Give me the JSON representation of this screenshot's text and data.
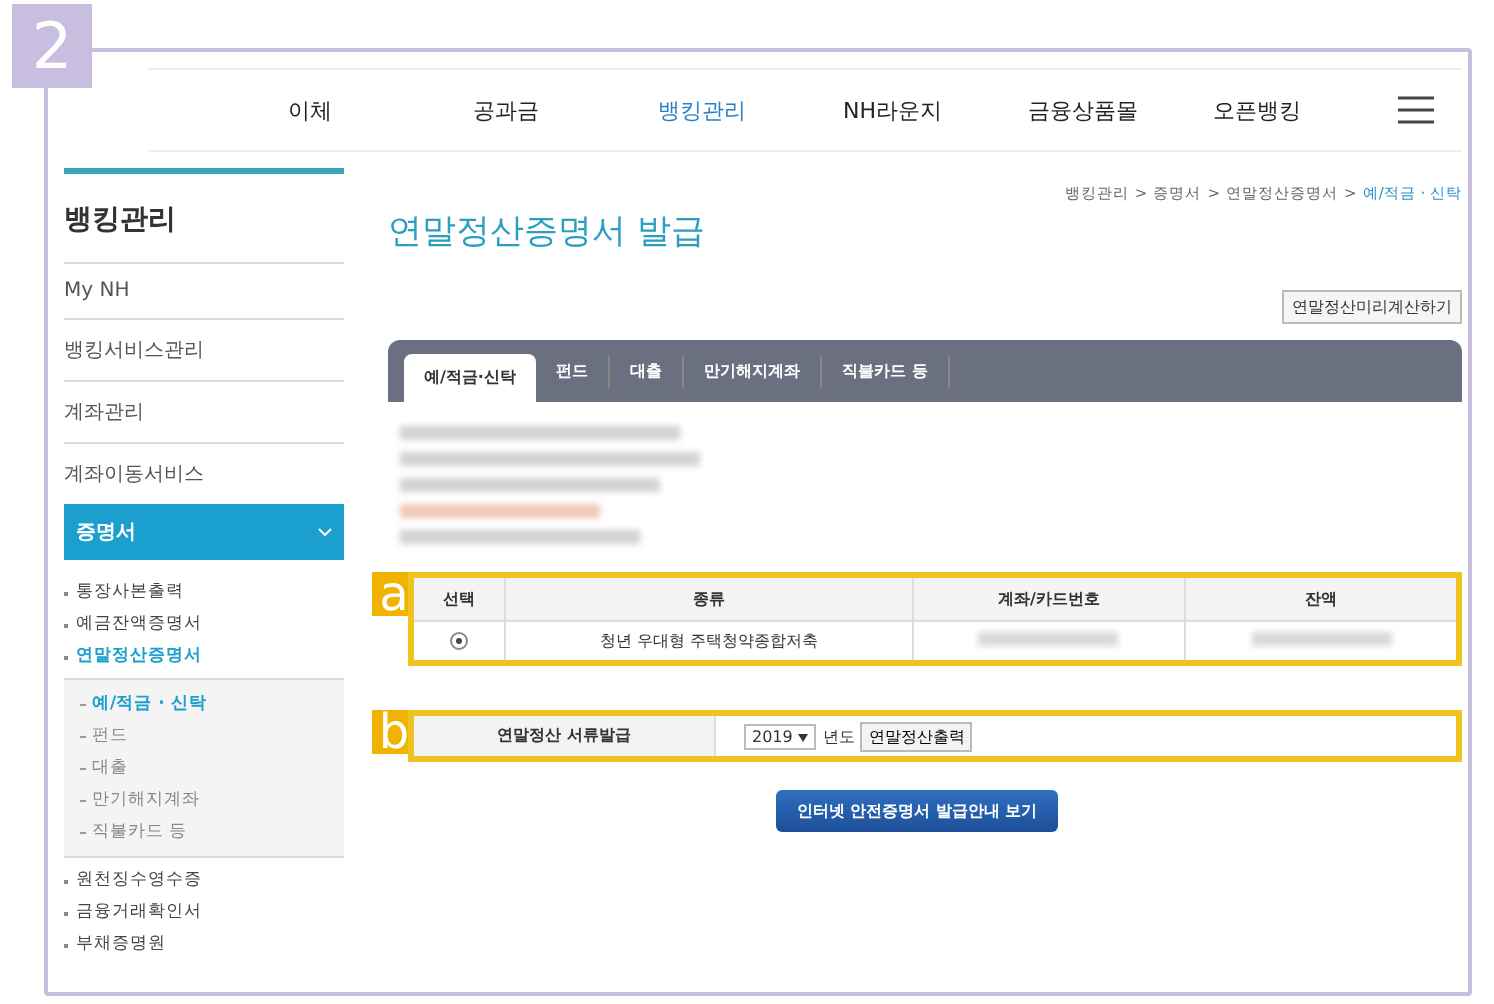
{
  "step_badge": "2",
  "nav": {
    "items": [
      {
        "label": "이체",
        "selected": false
      },
      {
        "label": "공과금",
        "selected": false
      },
      {
        "label": "뱅킹관리",
        "selected": true
      },
      {
        "label": "NH라운지",
        "selected": false
      },
      {
        "label": "금융상품몰",
        "selected": false
      },
      {
        "label": "오픈뱅킹",
        "selected": false
      }
    ]
  },
  "sidebar": {
    "title": "뱅킹관리",
    "items": [
      {
        "label": "My NH",
        "expanded": false
      },
      {
        "label": "뱅킹서비스관리",
        "expanded": false
      },
      {
        "label": "계좌관리",
        "expanded": false
      },
      {
        "label": "계좌이동서비스",
        "expanded": false
      },
      {
        "label": "증명서",
        "expanded": true,
        "children": [
          {
            "label": "통장사본출력",
            "selected": false
          },
          {
            "label": "예금잔액증명서",
            "selected": false
          },
          {
            "label": "연말정산증명서",
            "selected": true,
            "children": [
              {
                "label": "예/적금 · 신탁",
                "selected": true
              },
              {
                "label": "펀드",
                "selected": false
              },
              {
                "label": "대출",
                "selected": false
              },
              {
                "label": "만기해지계좌",
                "selected": false
              },
              {
                "label": "직불카드 등",
                "selected": false
              }
            ]
          },
          {
            "label": "원천징수영수증",
            "selected": false
          },
          {
            "label": "금융거래확인서",
            "selected": false
          },
          {
            "label": "부채증명원",
            "selected": false
          }
        ]
      }
    ]
  },
  "breadcrumb": {
    "separator": ">",
    "items": [
      "뱅킹관리",
      "증명서",
      "연말정산증명서",
      "예/적금 · 신탁"
    ]
  },
  "page_title": "연말정산증명서 발급",
  "preview_button": "연말정산미리계산하기",
  "tabs": [
    {
      "label": "예/적금·신탁",
      "selected": true
    },
    {
      "label": "펀드",
      "selected": false
    },
    {
      "label": "대출",
      "selected": false
    },
    {
      "label": "만기해지계좌",
      "selected": false
    },
    {
      "label": "직불카드 등",
      "selected": false
    }
  ],
  "account_table": {
    "callout": "a",
    "columns": [
      "선택",
      "종류",
      "계좌/카드번호",
      "잔액"
    ],
    "rows": [
      {
        "selected": true,
        "type": "청년 우대형 주택청약종합저축"
      }
    ]
  },
  "issue_form": {
    "callout": "b",
    "label": "연말정산 서류발급",
    "year": "2019",
    "year_unit": "년도",
    "print_button": "연말정산출력"
  },
  "guide_button": "인터넷 안전증명서 발급안내 보기"
}
